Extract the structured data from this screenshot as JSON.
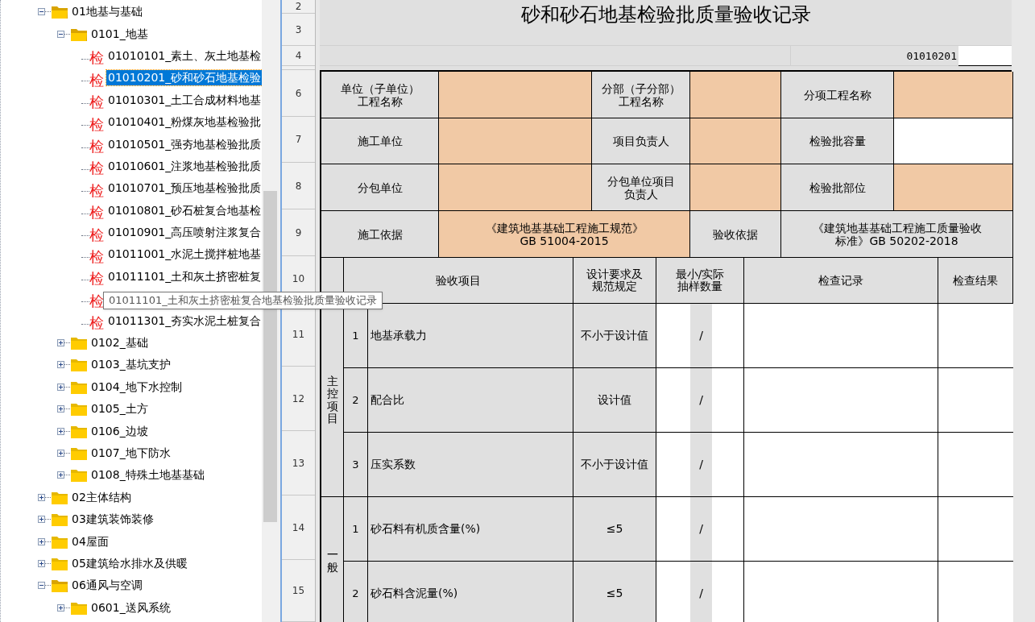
{
  "tree": {
    "items": [
      {
        "kind": "folder",
        "label": "01地基与基础",
        "expanded": true,
        "children": [
          {
            "kind": "folder",
            "label": "0101_地基",
            "expanded": true,
            "children": [
              {
                "kind": "leaf",
                "icon": "检",
                "label": "01010101_素土、灰土地基检",
                "selected": false
              },
              {
                "kind": "leaf",
                "icon": "检",
                "label": "01010201_砂和砂石地基检验",
                "selected": true
              },
              {
                "kind": "leaf",
                "icon": "检",
                "label": "01010301_土工合成材料地基",
                "selected": false
              },
              {
                "kind": "leaf",
                "icon": "检",
                "label": "01010401_粉煤灰地基检验批",
                "selected": false
              },
              {
                "kind": "leaf",
                "icon": "检",
                "label": "01010501_强夯地基检验批质",
                "selected": false
              },
              {
                "kind": "leaf",
                "icon": "检",
                "label": "01010601_注浆地基检验批质",
                "selected": false
              },
              {
                "kind": "leaf",
                "icon": "检",
                "label": "01010701_预压地基检验批质",
                "selected": false
              },
              {
                "kind": "leaf",
                "icon": "检",
                "label": "01010801_砂石桩复合地基检",
                "selected": false
              },
              {
                "kind": "leaf",
                "icon": "检",
                "label": "01010901_高压喷射注浆复合",
                "selected": false
              },
              {
                "kind": "leaf",
                "icon": "检",
                "label": "01011001_水泥土搅拌桩地基",
                "selected": false
              },
              {
                "kind": "leaf",
                "icon": "检",
                "label": "01011101_土和灰土挤密桩复",
                "selected": false
              },
              {
                "kind": "leaf",
                "icon": "检",
                "selected": false
              },
              {
                "kind": "leaf",
                "icon": "检",
                "label": "01011301_夯实水泥土桩复合",
                "selected": false
              }
            ]
          },
          {
            "kind": "folder",
            "label": "0102_基础",
            "expanded": false
          },
          {
            "kind": "folder",
            "label": "0103_基坑支护",
            "expanded": false
          },
          {
            "kind": "folder",
            "label": "0104_地下水控制",
            "expanded": false
          },
          {
            "kind": "folder",
            "label": "0105_土方",
            "expanded": false
          },
          {
            "kind": "folder",
            "label": "0106_边坡",
            "expanded": false
          },
          {
            "kind": "folder",
            "label": "0107_地下防水",
            "expanded": false
          },
          {
            "kind": "folder",
            "label": "0108_特殊土地基基础",
            "expanded": false
          }
        ]
      },
      {
        "kind": "folder",
        "label": "02主体结构",
        "expanded": false
      },
      {
        "kind": "folder",
        "label": "03建筑装饰装修",
        "expanded": false
      },
      {
        "kind": "folder",
        "label": "04屋面",
        "expanded": false
      },
      {
        "kind": "folder",
        "label": "05建筑给水排水及供暖",
        "expanded": false
      },
      {
        "kind": "folder",
        "label": "06通风与空调",
        "expanded": true,
        "children": [
          {
            "kind": "folder",
            "label": "0601_送风系统",
            "expanded": false
          }
        ]
      }
    ]
  },
  "tooltip": {
    "text": "01011101_土和灰土挤密桩复合地基检验批质量验收记录"
  },
  "sheet": {
    "row_numbers": [
      "2",
      "3",
      "4",
      "6",
      "7",
      "8",
      "9",
      "10",
      "11",
      "12",
      "13",
      "14",
      "15"
    ],
    "title": "砂和砂石地基检验批质量验收记录",
    "code": "01010201",
    "form_rows": [
      {
        "cells": [
          {
            "kind": "label",
            "lines": [
              "单位（子单位）",
              "工程名称"
            ]
          },
          {
            "kind": "value",
            "color": "#f1c9a5"
          },
          {
            "kind": "label",
            "lines": [
              "分部（子分部）",
              "工程名称"
            ]
          },
          {
            "kind": "value",
            "color": "#f1c9a5"
          },
          {
            "kind": "label",
            "lines": [
              "分项工程名称"
            ]
          },
          {
            "kind": "value",
            "color": "#f1c9a5"
          }
        ]
      },
      {
        "cells": [
          {
            "kind": "label",
            "lines": [
              "施工单位"
            ]
          },
          {
            "kind": "value",
            "color": "#f1c9a5"
          },
          {
            "kind": "label",
            "lines": [
              "项目负责人"
            ]
          },
          {
            "kind": "value",
            "color": "#f1c9a5"
          },
          {
            "kind": "label",
            "lines": [
              "检验批容量"
            ]
          },
          {
            "kind": "value",
            "color": "#ffffff"
          }
        ]
      },
      {
        "cells": [
          {
            "kind": "label",
            "lines": [
              "分包单位"
            ]
          },
          {
            "kind": "value",
            "color": "#f1c9a5"
          },
          {
            "kind": "label",
            "lines": [
              "分包单位项目",
              "负责人"
            ]
          },
          {
            "kind": "value",
            "color": "#f1c9a5"
          },
          {
            "kind": "label",
            "lines": [
              "检验批部位"
            ]
          },
          {
            "kind": "value",
            "color": "#f1c9a5"
          }
        ]
      },
      {
        "cells": [
          {
            "kind": "label",
            "lines": [
              "施工依据"
            ]
          },
          {
            "kind": "value",
            "color": "#f1c9a5",
            "lines": [
              "《建筑地基基础工程施工规范》",
              "GB 51004-2015"
            ]
          },
          {
            "kind": "label",
            "lines": [
              "验收依据"
            ]
          },
          {
            "kind": "value",
            "color": "#e0e0e0",
            "lines": [
              "《建筑地基基础工程施工质量验收",
              "标准》GB 50202-2018"
            ]
          }
        ]
      }
    ],
    "table": {
      "columns": [
        {
          "lines": [
            "验收项目"
          ]
        },
        {
          "lines": [
            "设计要求及",
            "规范规定"
          ]
        },
        {
          "lines": [
            "最小/实际",
            "抽样数量"
          ]
        },
        {
          "lines": [
            "检查记录"
          ]
        },
        {
          "lines": [
            "检查结果"
          ]
        }
      ],
      "groups": [
        {
          "label": "主控项目",
          "items": [
            {
              "no": "1",
              "name": "地基承载力",
              "requirement": "不小于设计值",
              "sample_separator": "/"
            },
            {
              "no": "2",
              "name": "配合比",
              "requirement": "设计值",
              "sample_separator": "/"
            },
            {
              "no": "3",
              "name": "压实系数",
              "requirement": "不小于设计值",
              "sample_separator": "/"
            }
          ]
        },
        {
          "label": "一般",
          "items": [
            {
              "no": "1",
              "name": "砂石料有机质含量(%)",
              "requirement": "≤5",
              "sample_separator": "/"
            },
            {
              "no": "2",
              "name": "砂石料含泥量(%)",
              "requirement": "≤5",
              "sample_separator": "/"
            }
          ]
        }
      ]
    }
  }
}
